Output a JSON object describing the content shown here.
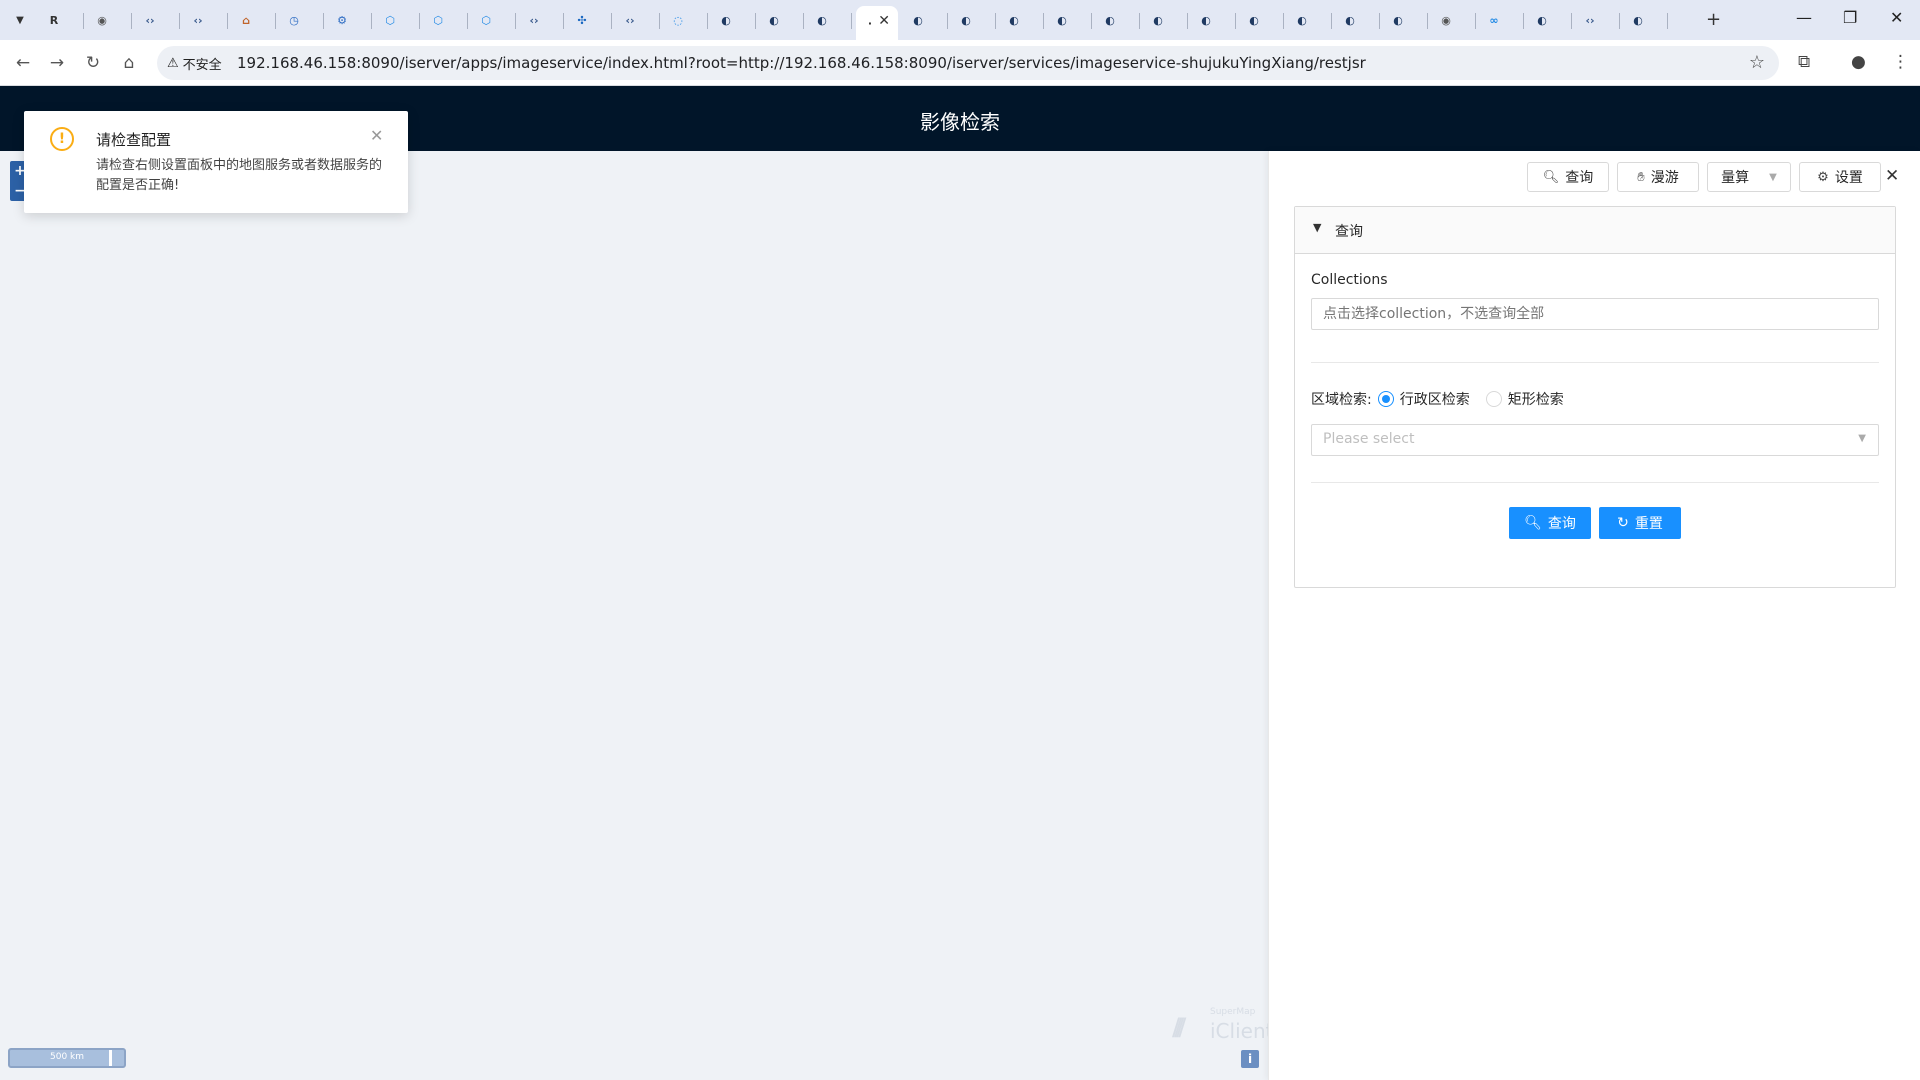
{
  "browser": {
    "tabs": [
      {
        "icon": "Ravi"
      },
      {
        "icon": "globe"
      },
      {
        "icon": "code"
      },
      {
        "icon": "code"
      },
      {
        "icon": "house"
      },
      {
        "icon": "history"
      },
      {
        "icon": "gear"
      },
      {
        "icon": "hex"
      },
      {
        "icon": "hex"
      },
      {
        "icon": "hex"
      },
      {
        "icon": "code"
      },
      {
        "icon": "puzzle"
      },
      {
        "icon": "code"
      },
      {
        "icon": "edge"
      },
      {
        "icon": "supermap"
      },
      {
        "icon": "supermap"
      },
      {
        "icon": "supermap"
      },
      {
        "icon": "active"
      },
      {
        "icon": "supermap"
      },
      {
        "icon": "supermap"
      },
      {
        "icon": "supermap"
      },
      {
        "icon": "supermap"
      },
      {
        "icon": "supermap"
      },
      {
        "icon": "supermap"
      },
      {
        "icon": "supermap"
      },
      {
        "icon": "supermap"
      },
      {
        "icon": "supermap"
      },
      {
        "icon": "supermap"
      },
      {
        "icon": "supermap"
      },
      {
        "icon": "globe"
      },
      {
        "icon": "link"
      },
      {
        "icon": "supermap"
      },
      {
        "icon": "code"
      },
      {
        "icon": "supermap"
      }
    ],
    "security_label": "不安全",
    "url": "192.168.46.158:8090/iserver/apps/imageservice/index.html?root=http://192.168.46.158:8090/iserver/services/imageservice-shujukuYingXiang/restjsr"
  },
  "app": {
    "title": "影像检索"
  },
  "notification": {
    "title": "请检查配置",
    "description": "请检查右侧设置面板中的地图服务或者数据服务的配置是否正确!"
  },
  "panel": {
    "toolbar": {
      "query_label": "查询",
      "pan_label": "漫游",
      "measure_label": "量算",
      "settings_label": "设置"
    },
    "section_title": "查询",
    "collections_label": "Collections",
    "collections_placeholder": "点击选择collection，不选查询全部",
    "region_label": "区域检索:",
    "region_options": [
      "行政区检索",
      "矩形检索"
    ],
    "region_select_placeholder": "Please select",
    "search_button": "查询",
    "reset_button": "重置"
  },
  "map": {
    "scale_label": "500 km",
    "logo_brand": "SuperMap",
    "logo_product": "iClient",
    "info_label": "i"
  },
  "colors": {
    "header_bg": "#011529",
    "primary": "#1890ff",
    "warning": "#faad14",
    "map_bg": "#eff2f6"
  }
}
